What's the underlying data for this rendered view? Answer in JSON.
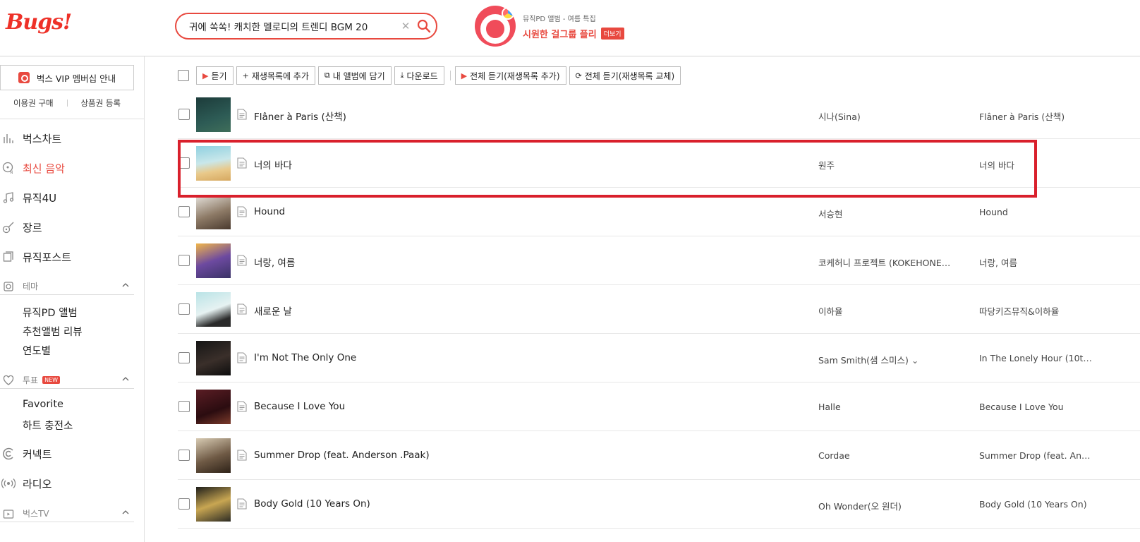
{
  "logo": "Bugs!",
  "search": {
    "value": "귀에 쏙쏙! 캐치한 멜로디의 트렌디 BGM 20"
  },
  "promo": {
    "subtitle": "뮤직PD 앨범 - 여름 특집",
    "title": "시원한 걸그룹 플리",
    "more": "더보기"
  },
  "sidebar": {
    "vip": "벅스 VIP 멤버십 안내",
    "buy_ticket": "이용권 구매",
    "gift_register": "상품권 등록",
    "items": [
      {
        "label": "벅스차트"
      },
      {
        "label": "최신 음악"
      },
      {
        "label": "뮤직4U"
      },
      {
        "label": "장르"
      },
      {
        "label": "뮤직포스트"
      }
    ],
    "theme": {
      "label": "테마",
      "subs": [
        "뮤직PD 앨범",
        "추천앨범 리뷰",
        "연도별"
      ]
    },
    "vote": {
      "label": "투표",
      "badge": "NEW",
      "subs": [
        "Favorite",
        "하트 충전소"
      ]
    },
    "connect": "커넥트",
    "radio": "라디오",
    "bugstv": "벅스TV"
  },
  "toolbar": {
    "listen": "듣기",
    "add_playlist": "재생목록에 추가",
    "add_album": "내 앨범에 담기",
    "download": "다운로드",
    "listen_all_add": "전체 듣기(재생목록 추가)",
    "listen_all_replace": "전체 듣기(재생목록 교체)"
  },
  "tracks": [
    {
      "title": "Flâner à Paris (산책)",
      "artist": "시나(Sina)",
      "album": "Flâner à Paris (산책)"
    },
    {
      "title": "너의 바다",
      "artist": "원주",
      "album": "너의 바다"
    },
    {
      "title": "Hound",
      "artist": "서승현",
      "album": "Hound"
    },
    {
      "title": "너랑, 여름",
      "artist": "코케허니 프로젝트 (KOKEHONEY …",
      "album": "너랑, 여름"
    },
    {
      "title": "새로운 날",
      "artist": "이하율",
      "album": "따당키즈뮤직&이하율"
    },
    {
      "title": "I'm Not The Only One",
      "artist": "Sam Smith(샘 스미스)",
      "album": "In The Lonely Hour (10th A…"
    },
    {
      "title": "Because I Love You",
      "artist": "Halle",
      "album": "Because I Love You"
    },
    {
      "title": "Summer Drop (feat. Anderson .Paak)",
      "artist": "Cordae",
      "album": "Summer Drop (feat. Ander…"
    },
    {
      "title": "Body Gold (10 Years On)",
      "artist": "Oh Wonder(오 원더)",
      "album": "Body Gold (10 Years On)"
    }
  ],
  "colors": {
    "brand": "#ee3128",
    "highlight": "#d9202c"
  }
}
